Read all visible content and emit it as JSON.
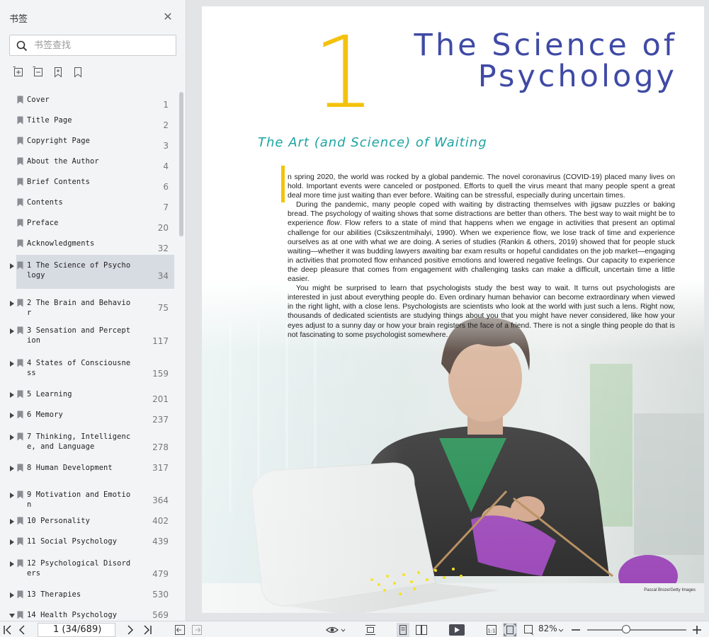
{
  "sidebar": {
    "title": "书签",
    "search_placeholder": "书签查找",
    "toc": [
      {
        "label": "Cover",
        "page": "1",
        "expandable": false
      },
      {
        "label": "Title Page",
        "page": "2",
        "expandable": false
      },
      {
        "label": "Copyright Page",
        "page": "3",
        "expandable": false
      },
      {
        "label": "About the Author",
        "page": "4",
        "expandable": false
      },
      {
        "label": "Brief Contents",
        "page": "6",
        "expandable": false
      },
      {
        "label": "Contents",
        "page": "7",
        "expandable": false
      },
      {
        "label": "Preface",
        "page": "20",
        "expandable": false
      },
      {
        "label": "Acknowledgments",
        "page": "32",
        "expandable": false
      },
      {
        "label": "1 The Science of Psychology",
        "page": "34",
        "expandable": true,
        "selected": true
      },
      {
        "label": "2 The Brain and Behavior",
        "page": "75",
        "expandable": true
      },
      {
        "label": "3 Sensation and Perception",
        "page": "117",
        "expandable": true
      },
      {
        "label": "4 States of Consciousness",
        "page": "159",
        "expandable": true
      },
      {
        "label": "5 Learning",
        "page": "201",
        "expandable": true
      },
      {
        "label": "6 Memory",
        "page": "237",
        "expandable": true
      },
      {
        "label": "7 Thinking, Intelligence, and Language",
        "page": "278",
        "expandable": true
      },
      {
        "label": "8 Human Development",
        "page": "317",
        "expandable": true
      },
      {
        "label": "9 Motivation and Emotion",
        "page": "364",
        "expandable": true
      },
      {
        "label": "10 Personality",
        "page": "402",
        "expandable": true
      },
      {
        "label": "11 Social Psychology",
        "page": "439",
        "expandable": true
      },
      {
        "label": "12 Psychological Disorders",
        "page": "479",
        "expandable": true
      },
      {
        "label": "13 Therapies",
        "page": "530",
        "expandable": true
      },
      {
        "label": "14 Health Psychology",
        "page": "569",
        "expandable": true,
        "expanded": true
      }
    ]
  },
  "page": {
    "chapter_number": "1",
    "chapter_title_line1": "The Science of",
    "chapter_title_line2": "Psychology",
    "section_title": "The Art (and Science) of Waiting",
    "para1": "n spring 2020, the world was rocked by a global pandemic. The novel coronavirus (COVID-19) placed many lives on hold. Important events were canceled or postponed. Efforts to quell the virus meant that many people spent a great deal more time just waiting than ever before. Waiting can be stressful, especially during uncertain times.",
    "para2_a": "During the pandemic, many people coped with waiting by distracting themselves with jigsaw puzzles or baking bread. The psychology of waiting shows that some distractions are better than others. The best way to wait might be to experience ",
    "para2_em": "flow",
    "para2_b": ". Flow refers to a state of mind that happens when we engage in activities that present an optimal challenge for our abilities (Csikszentmihalyi, 1990). When we experience flow, we lose track of time and experience ourselves as at one with what we are doing. A series of studies (Rankin & others, 2019) showed that for people stuck waiting—whether it was budding lawyers awaiting bar exam results or hopeful candidates on the job market—engaging in activities that promoted flow enhanced positive emotions and lowered negative feelings. Our capacity to experience the deep pleasure that comes from engagement with challenging tasks can make a difficult, uncertain time a little easier.",
    "para3": "You might be surprised to learn that psychologists study the best way to wait. It turns out psychologists are interested in just about everything people do. Even ordinary human behavior can become extraordinary when viewed in the right light, with a close lens. Psychologists are scientists who look at the world with just such a lens. Right now, thousands of dedicated scientists are studying things about you that you might have never considered, like how your eyes adjust to a sunny day or how your brain registers the face of a friend. There is not a single thing people do that is not fascinating to some psychologist somewhere.",
    "photo_credit": "Pascal Broze/Getty Images"
  },
  "toolbar": {
    "page_value": "1 (34/689)",
    "zoom": "82%",
    "zoom_fraction": 0.4
  },
  "colors": {
    "title_blue": "#3f4aa5",
    "accent_yellow": "#f4c20d",
    "subtitle_teal": "#1ea3a3",
    "sidebar_selected": "#d7dbe2"
  }
}
